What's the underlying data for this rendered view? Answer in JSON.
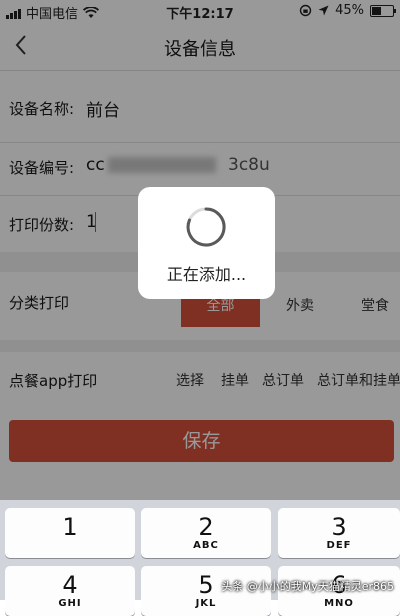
{
  "status_bar": {
    "carrier": "中国电信",
    "time": "下午12:17",
    "battery_percent": "45%",
    "battery_level": 0.45
  },
  "nav": {
    "back_icon": "chevron-left-icon",
    "title": "设备信息"
  },
  "form": {
    "device_name": {
      "label": "设备名称:",
      "value": "前台"
    },
    "device_number": {
      "label": "设备编号:",
      "value_start": "cc",
      "value_end": "3c8u"
    },
    "print_copies": {
      "label": "打印份数:",
      "value": "1"
    },
    "category_print": {
      "label": "分类打印",
      "options": [
        "全部",
        "外卖",
        "堂食"
      ],
      "selected": "全部"
    },
    "app_print": {
      "label": "点餐app打印",
      "options": [
        "选择",
        "挂单",
        "总订单",
        "总订单和挂单"
      ]
    },
    "save_label": "保存"
  },
  "toast": {
    "text": "正在添加..."
  },
  "keyboard": {
    "keys": [
      {
        "num": "1",
        "letters": ""
      },
      {
        "num": "2",
        "letters": "ABC"
      },
      {
        "num": "3",
        "letters": "DEF"
      },
      {
        "num": "4",
        "letters": "GHI"
      },
      {
        "num": "5",
        "letters": "JKL"
      },
      {
        "num": "6",
        "letters": "MNO"
      }
    ]
  },
  "watermark": "头条 @小小的我My天猫精灵er865",
  "colors": {
    "accent": "#d6503b"
  }
}
